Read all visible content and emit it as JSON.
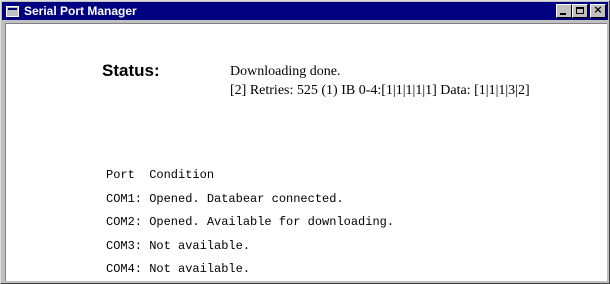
{
  "window": {
    "title": "Serial Port Manager"
  },
  "status": {
    "label": "Status:",
    "line1": "Downloading done.",
    "line2": "[2] Retries: 525 (1) IB 0-4:[1|1|1|1|1] Data: [1|1|1|3|2]"
  },
  "ports": {
    "header": "Port  Condition",
    "rows": [
      "COM1: Opened. Databear connected.",
      "COM2: Opened. Available for downloading.",
      "COM3: Not available.",
      "COM4: Not available."
    ]
  },
  "icons": {
    "app": "app-window-icon",
    "minimize": "minimize-icon",
    "maximize": "maximize-icon",
    "close": "close-icon"
  }
}
